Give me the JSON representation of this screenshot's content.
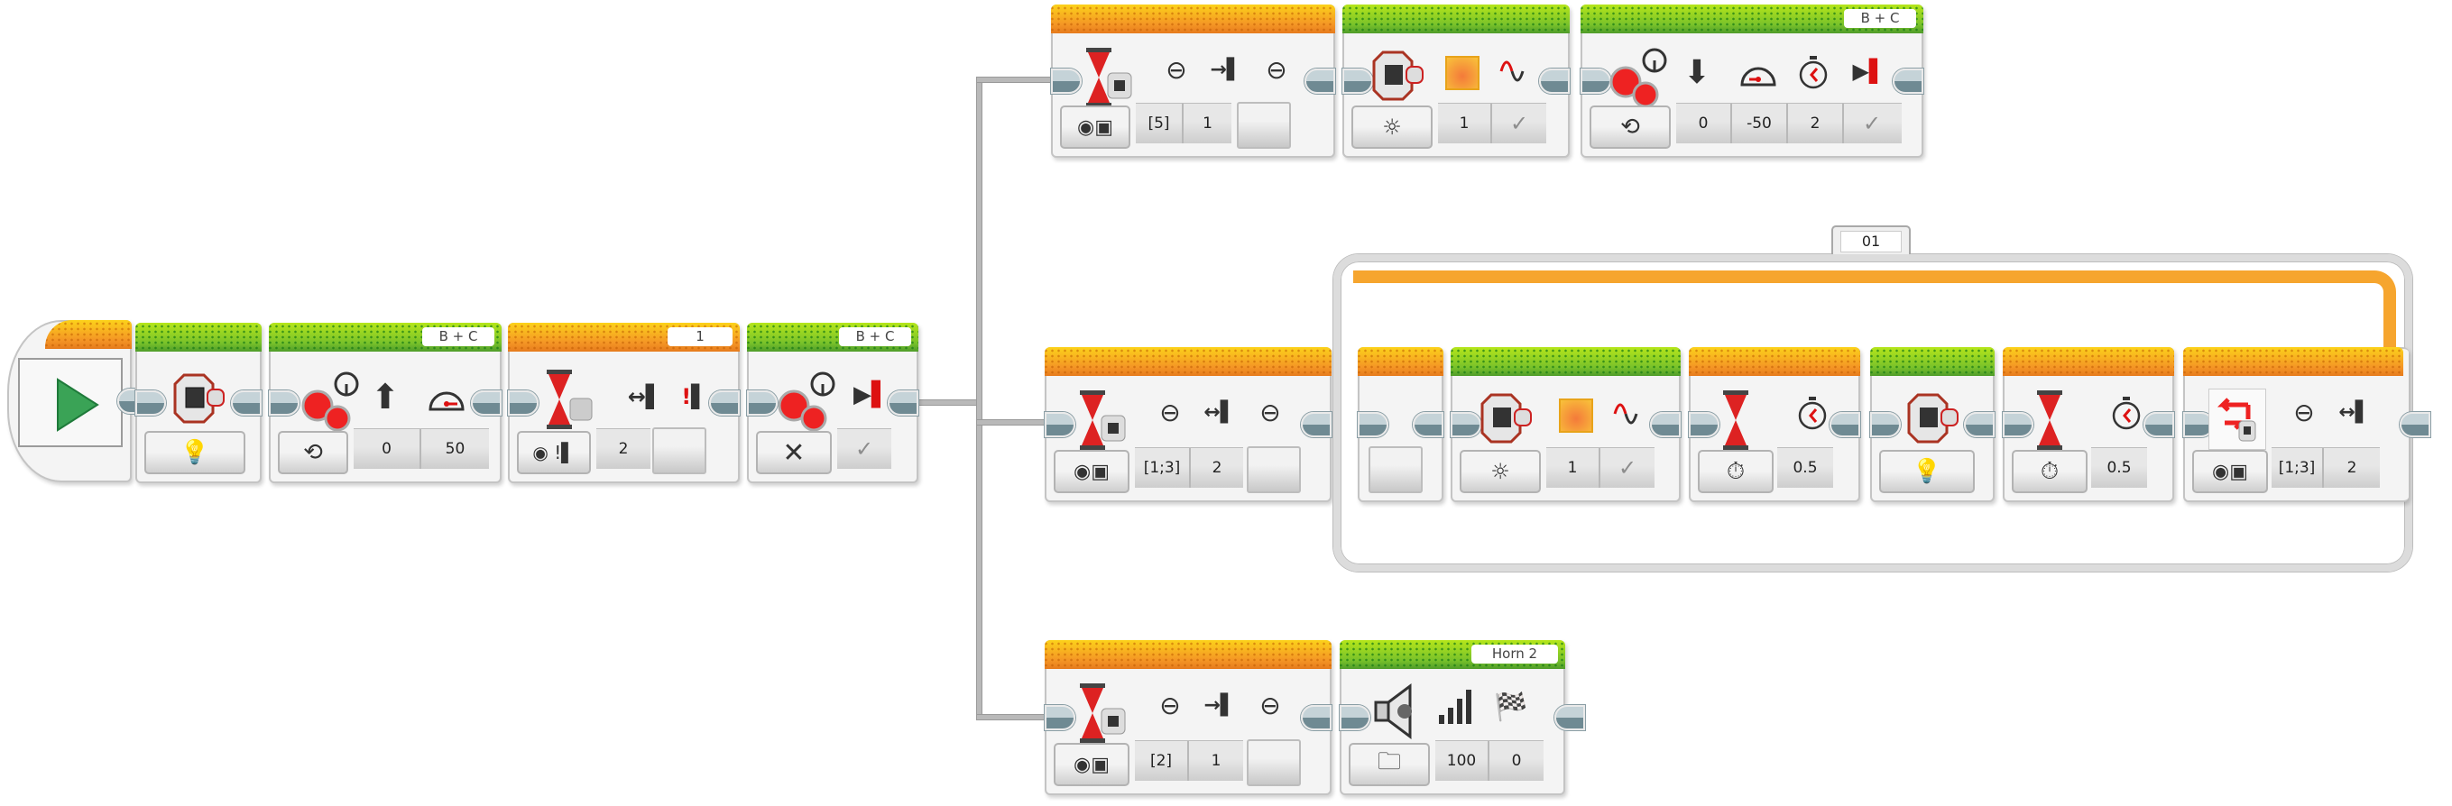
{
  "program": {
    "start": {
      "type": "start",
      "icon": "play-icon",
      "color": "#3aa356"
    },
    "main_sequence": [
      {
        "id": "brick-status-light",
        "category": "action",
        "header_color": "green",
        "icon": "brick-button-icon",
        "mode_icon": "lightbulb-icon",
        "params": []
      },
      {
        "id": "move-steering-on",
        "category": "action",
        "header_color": "green",
        "ports": "B + C",
        "icon": "move-steering-icon",
        "mode_icon": "rotate-on-icon",
        "param_icons": [
          "arrow-up-icon",
          "speedometer-icon"
        ],
        "params": [
          "0",
          "50"
        ]
      },
      {
        "id": "wait-motor-rotation",
        "category": "flow",
        "header_color": "orange",
        "ports": "1",
        "icon": "wait-hourglass-icon",
        "mode_icon": "compare-amount-icon",
        "param_icons": [
          "compare-type-icon",
          "threshold-icon"
        ],
        "params": [
          "2"
        ]
      },
      {
        "id": "move-steering-off",
        "category": "action",
        "header_color": "green",
        "ports": "B + C",
        "icon": "move-steering-icon",
        "mode_icon": "off-x-icon",
        "param_icons": [
          "brake-icon"
        ],
        "params": [
          "✓"
        ]
      }
    ],
    "branch_top": [
      {
        "id": "wait-brick-buttons-1",
        "category": "flow",
        "header_color": "orange",
        "icon": "wait-brick-button-icon",
        "mode_icon": "compare-brick-buttons-icon",
        "param_icons": [
          "button-ids-icon",
          "action-pressed-icon",
          "state-icon"
        ],
        "params": [
          "[5]",
          "1"
        ]
      },
      {
        "id": "brick-status-light-on",
        "category": "action",
        "header_color": "green",
        "icon": "brick-button-icon",
        "mode_icon": "light-on-icon",
        "param_icons": [
          "color-swatch-icon",
          "pulse-icon"
        ],
        "params": [
          "1",
          "✓"
        ]
      },
      {
        "id": "move-steering-seconds",
        "category": "action",
        "header_color": "green",
        "ports": "B + C",
        "icon": "move-steering-icon",
        "mode_icon": "seconds-timer-icon",
        "param_icons": [
          "arrow-down-icon",
          "speedometer-icon",
          "stopwatch-icon",
          "brake-icon"
        ],
        "params": [
          "0",
          "-50",
          "2",
          "✓"
        ]
      }
    ],
    "branch_middle": {
      "before_loop": {
        "id": "wait-brick-buttons-2",
        "category": "flow",
        "header_color": "orange",
        "icon": "wait-brick-button-icon",
        "mode_icon": "compare-brick-buttons-icon",
        "param_icons": [
          "button-ids-icon",
          "action-bumped-icon",
          "state-icon"
        ],
        "params": [
          "[1;3]",
          "2"
        ]
      },
      "loop": {
        "label": "01",
        "blocks": [
          {
            "id": "brick-light-on-loop",
            "category": "action",
            "header_color": "green",
            "icon": "brick-button-icon",
            "mode_icon": "light-on-icon",
            "param_icons": [
              "color-swatch-icon",
              "pulse-icon"
            ],
            "params": [
              "1",
              "✓"
            ]
          },
          {
            "id": "wait-time-1",
            "category": "flow",
            "header_color": "orange",
            "icon": "wait-hourglass-icon",
            "mode_icon": "stopwatch-icon",
            "param_icons": [
              "stopwatch-icon"
            ],
            "params": [
              "0.5"
            ]
          },
          {
            "id": "brick-light-off-loop",
            "category": "action",
            "header_color": "green",
            "icon": "brick-button-icon",
            "mode_icon": "lightbulb-icon",
            "params": []
          },
          {
            "id": "wait-time-2",
            "category": "flow",
            "header_color": "orange",
            "icon": "wait-hourglass-icon",
            "mode_icon": "stopwatch-icon",
            "param_icons": [
              "stopwatch-icon"
            ],
            "params": [
              "0.5"
            ]
          },
          {
            "id": "loop-exit-brick-buttons",
            "category": "flow",
            "header_color": "orange",
            "icon": "loop-repeat-icon",
            "mode_icon": "compare-brick-buttons-icon",
            "param_icons": [
              "button-ids-icon",
              "action-bumped-icon"
            ],
            "params": [
              "[1;3]",
              "2"
            ]
          }
        ]
      }
    },
    "branch_bottom": [
      {
        "id": "wait-brick-buttons-3",
        "category": "flow",
        "header_color": "orange",
        "icon": "wait-brick-button-icon",
        "mode_icon": "compare-brick-buttons-icon",
        "param_icons": [
          "button-ids-icon",
          "action-pressed-icon",
          "state-icon"
        ],
        "params": [
          "[2]",
          "1"
        ]
      },
      {
        "id": "sound-play-file",
        "category": "action",
        "header_color": "green",
        "label": "Horn 2",
        "icon": "speaker-icon",
        "mode_icon": "folder-icon",
        "param_icons": [
          "volume-icon",
          "play-type-icon"
        ],
        "params": [
          "100",
          "0"
        ]
      }
    ]
  }
}
